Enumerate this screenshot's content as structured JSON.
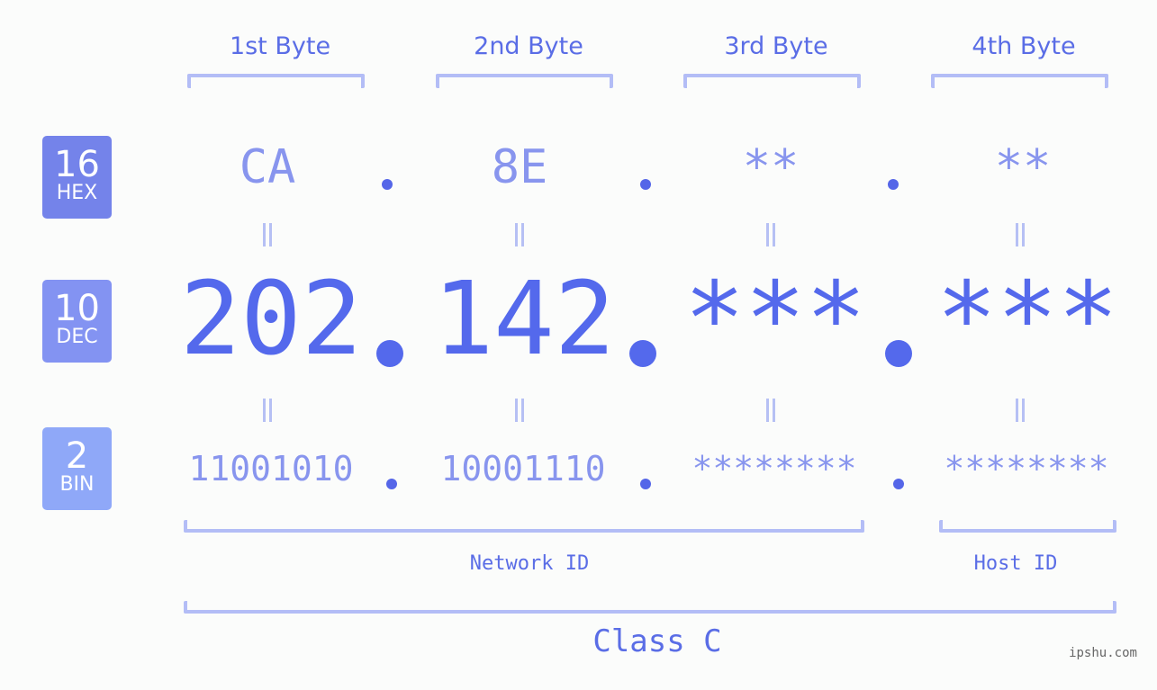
{
  "byte_headers": [
    "1st Byte",
    "2nd Byte",
    "3rd Byte",
    "4th Byte"
  ],
  "badges": {
    "hex": {
      "num": "16",
      "label": "HEX",
      "color": "#7483ea"
    },
    "dec": {
      "num": "10",
      "label": "DEC",
      "color": "#8393f2"
    },
    "bin": {
      "num": "2",
      "label": "BIN",
      "color": "#8fa8f8"
    }
  },
  "hex_values": [
    "CA",
    "8E",
    "**",
    "**"
  ],
  "dec_values": [
    "202",
    "142",
    "***",
    "***"
  ],
  "bin_values": [
    "11001010",
    "10001110",
    "********",
    "********"
  ],
  "network_label": "Network ID",
  "host_label": "Host ID",
  "class_label": "Class C",
  "watermark": "ipshu.com",
  "colors": {
    "accent": "#5469ec",
    "light_accent": "#8895ee",
    "bracket": "#b3bdf6",
    "background": "#fbfcfb"
  }
}
